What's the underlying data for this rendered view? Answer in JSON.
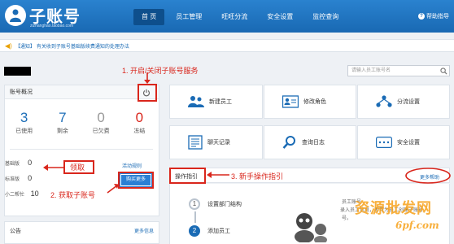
{
  "header": {
    "logo_title": "子账号",
    "logo_sub": "zizhanghao.taobao.com",
    "nav": [
      {
        "label": "首 页",
        "active": true
      },
      {
        "label": "员工管理",
        "active": false
      },
      {
        "label": "旺旺分流",
        "active": false
      },
      {
        "label": "安全设置",
        "active": false
      },
      {
        "label": "监控查询",
        "active": false
      }
    ],
    "help_label": "帮助指导"
  },
  "notice": {
    "tag": "【通知】",
    "text": "有关收到子账号基础版续费通知的处理办法"
  },
  "search": {
    "placeholder": "请输入员工账号名"
  },
  "overview": {
    "title": "账号概况",
    "stats": [
      {
        "value": "3",
        "label": "已使用",
        "color": "#1f6fb8"
      },
      {
        "value": "7",
        "label": "剩余",
        "color": "#1f6fb8"
      },
      {
        "value": "0",
        "label": "已欠费",
        "color": "#999999"
      },
      {
        "value": "0",
        "label": "冻结",
        "color": "#d9261c"
      }
    ],
    "limits": [
      {
        "label": "基础版",
        "value": "0"
      },
      {
        "label": "标准版",
        "value": "0"
      },
      {
        "label": "小二帮忙",
        "value": "10"
      }
    ],
    "rule_link": "活动规则",
    "buy_button": "购买更多"
  },
  "tiles": [
    {
      "label": "新建员工",
      "icon": "users-icon"
    },
    {
      "label": "修改角色",
      "icon": "role-card-icon"
    },
    {
      "label": "分流设置",
      "icon": "split-icon"
    },
    {
      "label": "聊天记录",
      "icon": "chat-record-icon"
    },
    {
      "label": "查询日志",
      "icon": "magnifier-icon"
    },
    {
      "label": "安全设置",
      "icon": "security-icon"
    }
  ],
  "guide": {
    "title": "操作指引",
    "more": "更多帮助",
    "steps": [
      {
        "num": "1",
        "label": "设置部门结构"
      },
      {
        "num": "2",
        "label": "添加员工"
      }
    ],
    "right_lines": [
      "员工账号",
      "录入员工信息，即可为员工创建子账号",
      "号。"
    ]
  },
  "bulletin": {
    "title": "公告",
    "more": "更多信息"
  },
  "annotations": {
    "a1": "1. 开启/关闭子账号服务",
    "a2": "2. 获取子账号",
    "a3": "3. 新手操作指引",
    "claim": "领取"
  },
  "watermark": {
    "text": "资源批发网",
    "url": "6pf.com"
  }
}
